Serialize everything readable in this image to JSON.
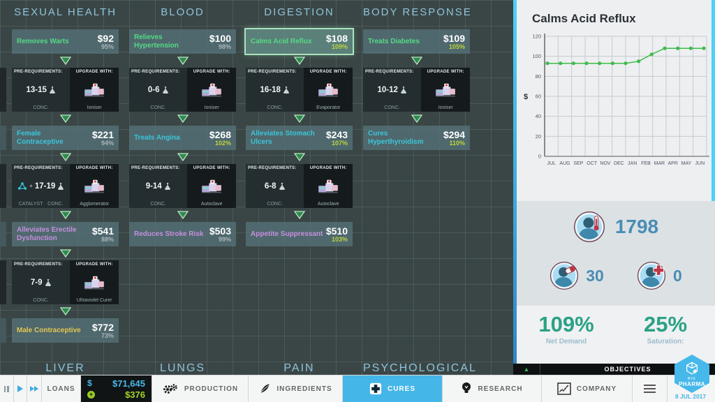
{
  "market": {
    "labels": {
      "prereq": "PRE-REQUIREMENTS:",
      "upgrade": "UPGRADE WITH:",
      "conc": "CONC.",
      "catalyst": "CATALYST",
      "plus": "+"
    },
    "colors": {
      "tier_green": "#55db85",
      "tier_cyan": "#3cc6da",
      "tier_purple": "#c58fdd",
      "tier_yellow": "#e5c64f",
      "pct_gray": "#a9b6ba",
      "pct_green": "#bcd43e"
    },
    "columns": [
      {
        "header": "SEXUAL HEALTH",
        "cure1": {
          "name": "Removes Warts",
          "price": "$92",
          "percent": "95%",
          "name_color": "#55db85",
          "percent_color": "#a9b6ba"
        },
        "pre1": {
          "range": "13-15",
          "upgrade": "Ioniser"
        },
        "cure2": {
          "name": "Female Contraceptive",
          "price": "$221",
          "percent": "94%",
          "name_color": "#3cc6da",
          "percent_color": "#a9b6ba"
        },
        "pre2": {
          "range": "17-19",
          "upgrade": "Agglomerator"
        },
        "cure3": {
          "name": "Alleviates Erectile Dysfunction",
          "price": "$541",
          "percent": "88%",
          "name_color": "#c58fdd",
          "percent_color": "#a9b6ba"
        },
        "pre3": {
          "range": "7-9",
          "upgrade": "Ultraviolet Curer"
        },
        "cure4": {
          "name": "Male Contraceptive",
          "price": "$772",
          "percent": "73%",
          "name_color": "#e5c64f",
          "percent_color": "#a9b6ba"
        }
      },
      {
        "header": "BLOOD",
        "cure1": {
          "name": "Relieves Hypertension",
          "price": "$100",
          "percent": "98%",
          "name_color": "#55db85",
          "percent_color": "#a9b6ba"
        },
        "pre1": {
          "range": "0-6",
          "upgrade": "Ioniser"
        },
        "cure2": {
          "name": "Treats Angina",
          "price": "$268",
          "percent": "102%",
          "name_color": "#3cc6da",
          "percent_color": "#bcd43e"
        },
        "pre2": {
          "range": "9-14",
          "upgrade": "Autoclave"
        },
        "cure3": {
          "name": "Reduces Stroke Risk",
          "price": "$503",
          "percent": "99%",
          "name_color": "#c58fdd",
          "percent_color": "#a9b6ba"
        }
      },
      {
        "header": "DIGESTION",
        "cure1": {
          "name": "Calms Acid Reflux",
          "price": "$108",
          "percent": "109%",
          "name_color": "#55db85",
          "percent_color": "#bcd43e"
        },
        "pre1": {
          "range": "16-18",
          "upgrade": "Evaporator"
        },
        "cure2": {
          "name": "Alleviates Stomach Ulcers",
          "price": "$243",
          "percent": "107%",
          "name_color": "#3cc6da",
          "percent_color": "#bcd43e"
        },
        "pre2": {
          "range": "6-8",
          "upgrade": "Autoclave"
        },
        "cure3": {
          "name": "Appetite Suppressant",
          "price": "$510",
          "percent": "103%",
          "name_color": "#c58fdd",
          "percent_color": "#bcd43e"
        }
      },
      {
        "header": "BODY RESPONSE",
        "cure1": {
          "name": "Treats Diabetes",
          "price": "$109",
          "percent": "105%",
          "name_color": "#55db85",
          "percent_color": "#bcd43e"
        },
        "pre1": {
          "range": "10-12",
          "upgrade": "Ioniser"
        },
        "cure2": {
          "name": "Cures Hyperthyroidism",
          "price": "$294",
          "percent": "110%",
          "name_color": "#3cc6da",
          "percent_color": "#bcd43e"
        }
      }
    ],
    "partial_headers": {
      "h1": "LIVER",
      "h2": "LUNGS",
      "h3": "PAIN",
      "h4": "PSYCHOLOGICAL"
    }
  },
  "detail_panel": {
    "title": "Calms Acid Reflux",
    "chart_data": {
      "type": "line",
      "title": "Calms Acid Reflux",
      "x": [
        "JUL",
        "AUG",
        "SEP",
        "OCT",
        "NOV",
        "DEC",
        "JAN",
        "FEB",
        "MAR",
        "APR",
        "MAY",
        "JUN"
      ],
      "values": [
        93,
        93,
        93,
        93,
        93,
        93,
        93,
        95,
        102,
        108,
        108,
        108,
        108
      ],
      "ylabel": "$",
      "yticks": [
        0,
        20,
        40,
        60,
        80,
        100,
        120
      ],
      "ylim": [
        0,
        120
      ],
      "line_color": "#3dbb4a",
      "grid": true,
      "legend": "none"
    },
    "stats": {
      "sick": "1798",
      "treated": "30",
      "cured": "0"
    },
    "net_demand": {
      "value": "109%",
      "label": "Net Demand"
    },
    "saturation": {
      "value": "25%",
      "label": "Saturation:"
    }
  },
  "objectives": {
    "label": "OBJECTIVES",
    "expander_icon": "▲"
  },
  "toolbar": {
    "loans_label": "LOANS",
    "cash_symbol": "$",
    "cash": "$71,645",
    "income": "$376",
    "production_label": "PRODUCTION",
    "ingredients_label": "INGREDIENTS",
    "cures_label": "CURES",
    "research_label": "RESEARCH",
    "company_label": "COMPANY",
    "accent_blue": "#45b6e8",
    "cash_color": "#4ab8e8",
    "income_color": "#a6d32a"
  },
  "logo": {
    "line1": "BIG",
    "line2": "PHARMA",
    "date": "8 JUL 2017"
  }
}
